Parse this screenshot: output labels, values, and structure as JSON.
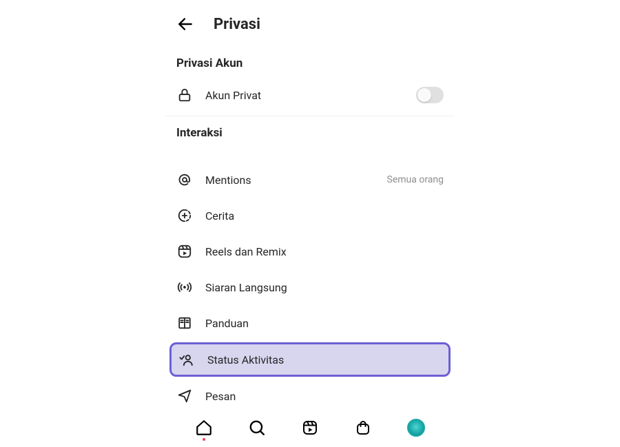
{
  "header": {
    "title": "Privasi"
  },
  "sections": {
    "account": {
      "header": "Privasi Akun",
      "private_label": "Akun Privat",
      "private_value": false
    },
    "interactions": {
      "header": "Interaksi",
      "items": {
        "mentions": {
          "label": "Mentions",
          "value": "Semua orang"
        },
        "story": {
          "label": "Cerita"
        },
        "reels": {
          "label": "Reels dan Remix"
        },
        "live": {
          "label": "Siaran Langsung"
        },
        "guides": {
          "label": "Panduan"
        },
        "activity_status": {
          "label": "Status Aktivitas"
        },
        "messages": {
          "label": "Pesan"
        }
      }
    }
  },
  "highlighted_item": "activity_status"
}
